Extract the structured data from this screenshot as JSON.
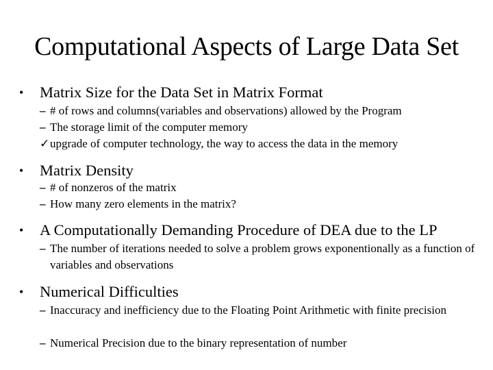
{
  "slide": {
    "title": "Computational Aspects of Large Data Set",
    "bullet_glyph": "•",
    "dash_glyph": "–",
    "check_glyph": "✓",
    "sections": [
      {
        "heading": "Matrix Size for the Data Set in Matrix Format",
        "items": [
          {
            "marker": "dash",
            "text": "# of rows and columns(variables and observations) allowed by the Program"
          },
          {
            "marker": "dash",
            "text": "The storage limit of the computer memory"
          },
          {
            "marker": "check",
            "text": "upgrade of computer technology, the way to access the data in the memory"
          }
        ]
      },
      {
        "heading": "Matrix Density",
        "items": [
          {
            "marker": "dash",
            "text": "# of nonzeros of the matrix"
          },
          {
            "marker": "dash",
            "text": "How many zero elements in the matrix?"
          }
        ]
      },
      {
        "heading": "A Computationally Demanding Procedure of DEA due to the LP",
        "items": [
          {
            "marker": "dash",
            "text": "The number of iterations needed to solve a problem grows exponentionally as a function of variables and observations"
          }
        ]
      },
      {
        "heading": "Numerical Difficulties",
        "items": [
          {
            "marker": "dash",
            "text": "Inaccuracy and inefficiency due to the Floating Point Arithmetic with finite precision"
          },
          {
            "marker": "dash",
            "text": "Numerical Precision due to the binary representation of number"
          }
        ]
      }
    ]
  }
}
